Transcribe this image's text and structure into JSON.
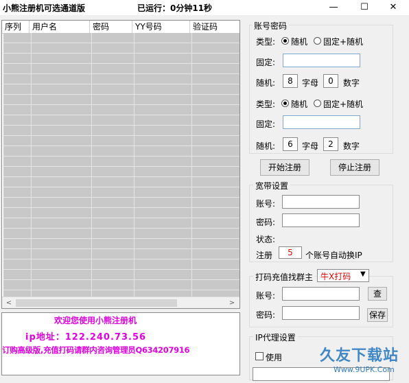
{
  "window": {
    "title": "小熊注册机可选通道版",
    "uptime": "已运行：0分钟11秒",
    "min_icon": "—",
    "max_icon": "☐",
    "close_icon": "✕"
  },
  "table": {
    "columns": [
      "序列",
      "用户名",
      "密码",
      "YY号码",
      "验证码"
    ],
    "scroll_left": "<",
    "scroll_right": ">"
  },
  "welcome": {
    "line1": "欢迎您使用小熊注册机",
    "line2": "ip地址：122.240.73.56",
    "line3": "订购高级版,充值打码请群内咨询管理员Q634207916"
  },
  "account": {
    "group_title": "账号密码",
    "type_label": "类型:",
    "radio_random": "随机",
    "radio_fixed_random": "固定+随机",
    "fixed_label": "固定:",
    "random_label": "随机:",
    "letters_label": "字母",
    "digits_label": "数字",
    "user_letters": "8",
    "user_digits": "0",
    "pass_letters": "6",
    "pass_digits": "2",
    "start_button": "开始注册",
    "stop_button": "停止注册"
  },
  "broadband": {
    "group_title": "宽带设置",
    "account_label": "账号:",
    "password_label": "密码:",
    "status_label": "状态:",
    "register_label": "注册",
    "register_count": "5",
    "switch_ip_text": "个账号自动换IP"
  },
  "captcha": {
    "group_title": "打码充值找群主",
    "service_select": "牛X打码",
    "account_label": "账号:",
    "password_label": "密码:",
    "query_button": "查",
    "save_button": "保存"
  },
  "proxy": {
    "group_title": "IP代理设置",
    "use_label": "使用"
  },
  "watermark": {
    "brand": "久友下载站",
    "url": "Www.9UPK.Com"
  },
  "colors": {
    "welcome_text": "#e000e0",
    "register_count": "#e00000",
    "select_text": "#e00000"
  }
}
